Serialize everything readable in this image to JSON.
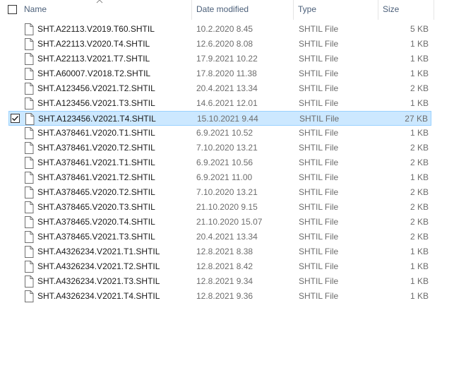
{
  "columns": {
    "name": "Name",
    "date_modified": "Date modified",
    "type": "Type",
    "size": "Size"
  },
  "icons": {
    "file": "file-icon",
    "sort": "sort-ascending-icon",
    "check": "checkmark-icon"
  },
  "colors": {
    "selection_bg": "#cce8ff",
    "selection_border": "#99d1ff",
    "header_text": "#4c607a",
    "secondary_text": "#6d6d6d"
  },
  "files": [
    {
      "name": "SHT.A22113.V2019.T60.SHTIL",
      "date": "10.2.2020 8.45",
      "type": "SHTIL File",
      "size": "5 KB",
      "selected": false
    },
    {
      "name": "SHT.A22113.V2020.T4.SHTIL",
      "date": "12.6.2020 8.08",
      "type": "SHTIL File",
      "size": "1 KB",
      "selected": false
    },
    {
      "name": "SHT.A22113.V2021.T7.SHTIL",
      "date": "17.9.2021 10.22",
      "type": "SHTIL File",
      "size": "1 KB",
      "selected": false
    },
    {
      "name": "SHT.A60007.V2018.T2.SHTIL",
      "date": "17.8.2020 11.38",
      "type": "SHTIL File",
      "size": "1 KB",
      "selected": false
    },
    {
      "name": "SHT.A123456.V2021.T2.SHTIL",
      "date": "20.4.2021 13.34",
      "type": "SHTIL File",
      "size": "2 KB",
      "selected": false
    },
    {
      "name": "SHT.A123456.V2021.T3.SHTIL",
      "date": "14.6.2021 12.01",
      "type": "SHTIL File",
      "size": "1 KB",
      "selected": false
    },
    {
      "name": "SHT.A123456.V2021.T4.SHTIL",
      "date": "15.10.2021 9.44",
      "type": "SHTIL File",
      "size": "27 KB",
      "selected": true
    },
    {
      "name": "SHT.A378461.V2020.T1.SHTIL",
      "date": "6.9.2021 10.52",
      "type": "SHTIL File",
      "size": "1 KB",
      "selected": false
    },
    {
      "name": "SHT.A378461.V2020.T2.SHTIL",
      "date": "7.10.2020 13.21",
      "type": "SHTIL File",
      "size": "2 KB",
      "selected": false
    },
    {
      "name": "SHT.A378461.V2021.T1.SHTIL",
      "date": "6.9.2021 10.56",
      "type": "SHTIL File",
      "size": "2 KB",
      "selected": false
    },
    {
      "name": "SHT.A378461.V2021.T2.SHTIL",
      "date": "6.9.2021 11.00",
      "type": "SHTIL File",
      "size": "1 KB",
      "selected": false
    },
    {
      "name": "SHT.A378465.V2020.T2.SHTIL",
      "date": "7.10.2020 13.21",
      "type": "SHTIL File",
      "size": "2 KB",
      "selected": false
    },
    {
      "name": "SHT.A378465.V2020.T3.SHTIL",
      "date": "21.10.2020 9.15",
      "type": "SHTIL File",
      "size": "2 KB",
      "selected": false
    },
    {
      "name": "SHT.A378465.V2020.T4.SHTIL",
      "date": "21.10.2020 15.07",
      "type": "SHTIL File",
      "size": "2 KB",
      "selected": false
    },
    {
      "name": "SHT.A378465.V2021.T3.SHTIL",
      "date": "20.4.2021 13.34",
      "type": "SHTIL File",
      "size": "2 KB",
      "selected": false
    },
    {
      "name": "SHT.A4326234.V2021.T1.SHTIL",
      "date": "12.8.2021 8.38",
      "type": "SHTIL File",
      "size": "1 KB",
      "selected": false
    },
    {
      "name": "SHT.A4326234.V2021.T2.SHTIL",
      "date": "12.8.2021 8.42",
      "type": "SHTIL File",
      "size": "1 KB",
      "selected": false
    },
    {
      "name": "SHT.A4326234.V2021.T3.SHTIL",
      "date": "12.8.2021 9.34",
      "type": "SHTIL File",
      "size": "1 KB",
      "selected": false
    },
    {
      "name": "SHT.A4326234.V2021.T4.SHTIL",
      "date": "12.8.2021 9.36",
      "type": "SHTIL File",
      "size": "1 KB",
      "selected": false
    }
  ]
}
